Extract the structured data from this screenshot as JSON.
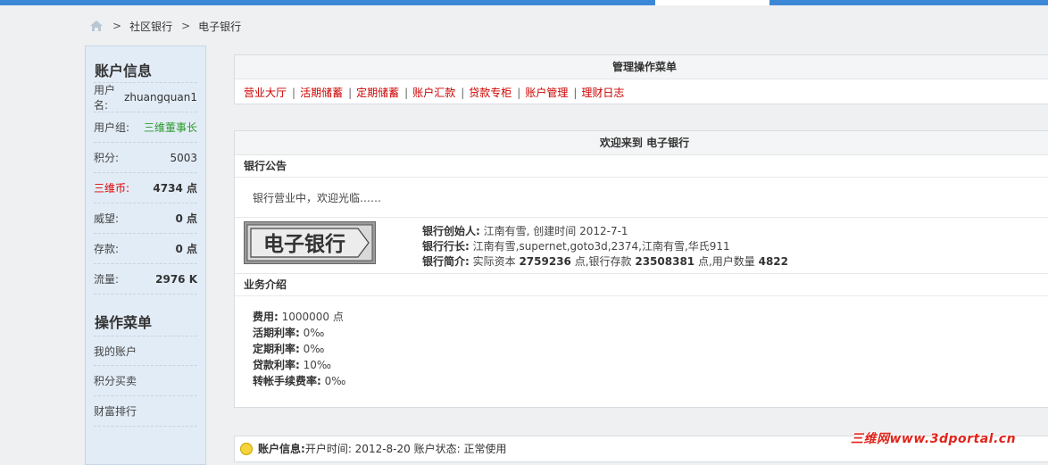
{
  "breadcrumb": {
    "sep": ">",
    "items": [
      "社区银行",
      "电子银行"
    ]
  },
  "sidebar": {
    "account_title": "账户信息",
    "rows": [
      {
        "label": "用户名:",
        "value": "zhuangquan1"
      },
      {
        "label": "用户组:",
        "value": "三维董事长"
      },
      {
        "label": "积分:",
        "value": "5003"
      },
      {
        "label": "三维币:",
        "value": "4734 点"
      },
      {
        "label": "威望:",
        "value": "0 点"
      },
      {
        "label": "存款:",
        "value": "0 点"
      },
      {
        "label": "流量:",
        "value": "2976 K"
      }
    ],
    "menu_title": "操作菜单",
    "menu": [
      "我的账户",
      "积分买卖",
      "财富排行"
    ]
  },
  "manage_panel": {
    "title": "管理操作菜单",
    "links": [
      "营业大厅",
      "活期储蓄",
      "定期储蓄",
      "账户汇款",
      "贷款专柜",
      "账户管理",
      "理财日志"
    ],
    "separator": "|"
  },
  "welcome_panel": {
    "title": "欢迎来到 电子银行",
    "notice_title": "银行公告",
    "notice_text": "银行营业中，欢迎光临……",
    "logo_text": "电子银行",
    "founder_label": "银行创始人:",
    "founder_value": " 江南有雪, 创建时间 2012-7-1",
    "president_label": "银行行长:",
    "president_value": " 江南有雪,supernet,goto3d,2374,江南有雪,华氏911",
    "intro_label": "银行简介:",
    "intro_t1": " 实际资本 ",
    "intro_capital": "2759236",
    "intro_t2": " 点,银行存款 ",
    "intro_deposit": "23508381",
    "intro_t3": " 点,用户数量 ",
    "intro_users": "4822",
    "biz_title": "业务介绍",
    "biz": [
      {
        "label": "费用:",
        "value": " 1000000 点"
      },
      {
        "label": "活期利率:",
        "value": " 0‰"
      },
      {
        "label": "定期利率:",
        "value": " 0‰"
      },
      {
        "label": "贷款利率:",
        "value": " 10‰"
      },
      {
        "label": "转帐手续费率:",
        "value": " 0‰"
      }
    ]
  },
  "account_panel": {
    "label": "账户信息:",
    "text": " 开户时间: 2012-8-20  账户状态: 正常使用"
  },
  "watermark": "三维网www.3dportal.cn",
  "colors": {
    "accent": "#3d88d6",
    "link": "#cc0000",
    "group": "#2a9a2a"
  }
}
